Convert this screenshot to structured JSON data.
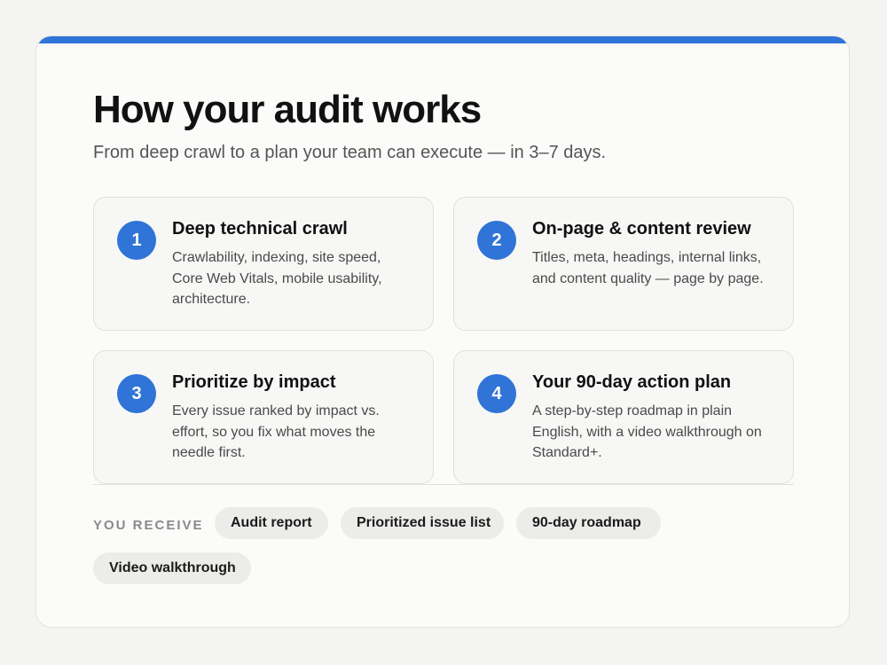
{
  "colors": {
    "accent": "#2f74d6",
    "step_badge": "#2f74d6"
  },
  "header": {
    "title": "How your audit works",
    "subtitle": "From deep crawl to a plan your team can execute — in 3–7 days."
  },
  "steps": [
    {
      "number": "1",
      "title": "Deep technical crawl",
      "description": "Crawlability, indexing, site speed, Core Web Vitals, mobile usability, architecture."
    },
    {
      "number": "2",
      "title": "On-page & content review",
      "description": "Titles, meta, headings, internal links, and content quality — page by page."
    },
    {
      "number": "3",
      "title": "Prioritize by impact",
      "description": "Every issue ranked by impact vs. effort, so you fix what moves the needle first."
    },
    {
      "number": "4",
      "title": "Your 90-day action plan",
      "description": "A step-by-step roadmap in plain English, with a video walkthrough on Standard+."
    }
  ],
  "deliverables": {
    "label": "YOU RECEIVE",
    "items": [
      "Audit report",
      "Prioritized issue list",
      "90-day roadmap",
      "Video walkthrough"
    ]
  }
}
